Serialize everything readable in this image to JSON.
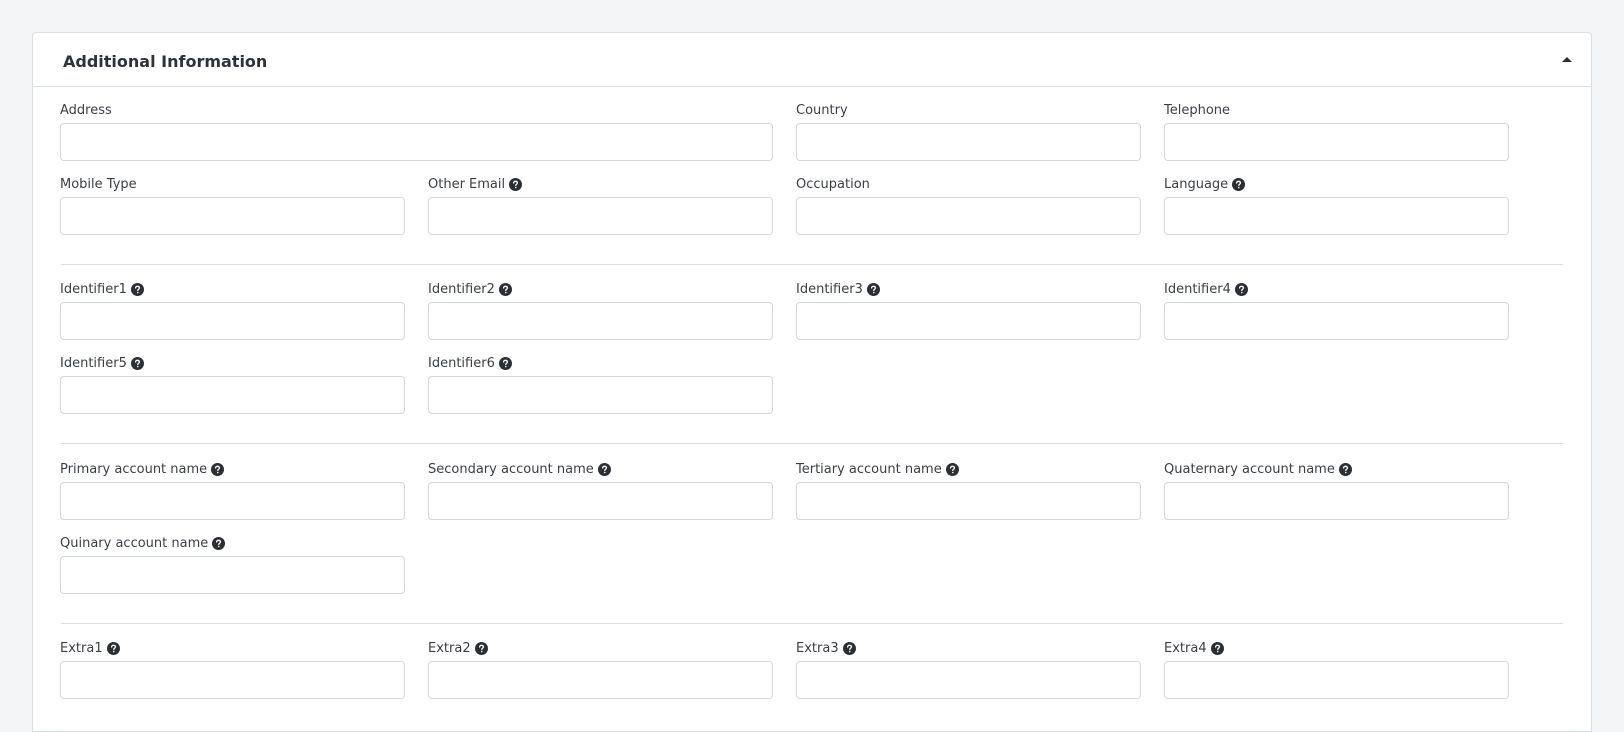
{
  "panel": {
    "title": "Additional Information",
    "toggle_icon": "caret-up-icon"
  },
  "fields": {
    "address": {
      "label": "Address",
      "value": "",
      "help": false
    },
    "country": {
      "label": "Country",
      "value": "",
      "help": false
    },
    "telephone": {
      "label": "Telephone",
      "value": "",
      "help": false
    },
    "mobile_type": {
      "label": "Mobile Type",
      "value": "",
      "help": false
    },
    "other_email": {
      "label": "Other Email",
      "value": "",
      "help": true
    },
    "occupation": {
      "label": "Occupation",
      "value": "",
      "help": false
    },
    "language": {
      "label": "Language",
      "value": "",
      "help": true
    },
    "identifier1": {
      "label": "Identifier1",
      "value": "",
      "help": true
    },
    "identifier2": {
      "label": "Identifier2",
      "value": "",
      "help": true
    },
    "identifier3": {
      "label": "Identifier3",
      "value": "",
      "help": true
    },
    "identifier4": {
      "label": "Identifier4",
      "value": "",
      "help": true
    },
    "identifier5": {
      "label": "Identifier5",
      "value": "",
      "help": true
    },
    "identifier6": {
      "label": "Identifier6",
      "value": "",
      "help": true
    },
    "primary_account_name": {
      "label": "Primary account name",
      "value": "",
      "help": true
    },
    "secondary_account_name": {
      "label": "Secondary account name",
      "value": "",
      "help": true
    },
    "tertiary_account_name": {
      "label": "Tertiary account name",
      "value": "",
      "help": true
    },
    "quaternary_account_name": {
      "label": "Quaternary account name",
      "value": "",
      "help": true
    },
    "quinary_account_name": {
      "label": "Quinary account name",
      "value": "",
      "help": true
    },
    "extra1": {
      "label": "Extra1",
      "value": "",
      "help": true
    },
    "extra2": {
      "label": "Extra2",
      "value": "",
      "help": true
    },
    "extra3": {
      "label": "Extra3",
      "value": "",
      "help": true
    },
    "extra4": {
      "label": "Extra4",
      "value": "",
      "help": true
    }
  },
  "colors": {
    "background": "#f4f5f7",
    "panel_border": "#dadde2",
    "input_border": "#d3d6db",
    "help_icon": "#2b2e33",
    "text": "#3b3f45"
  },
  "icons": {
    "help": "question-circle-icon"
  }
}
